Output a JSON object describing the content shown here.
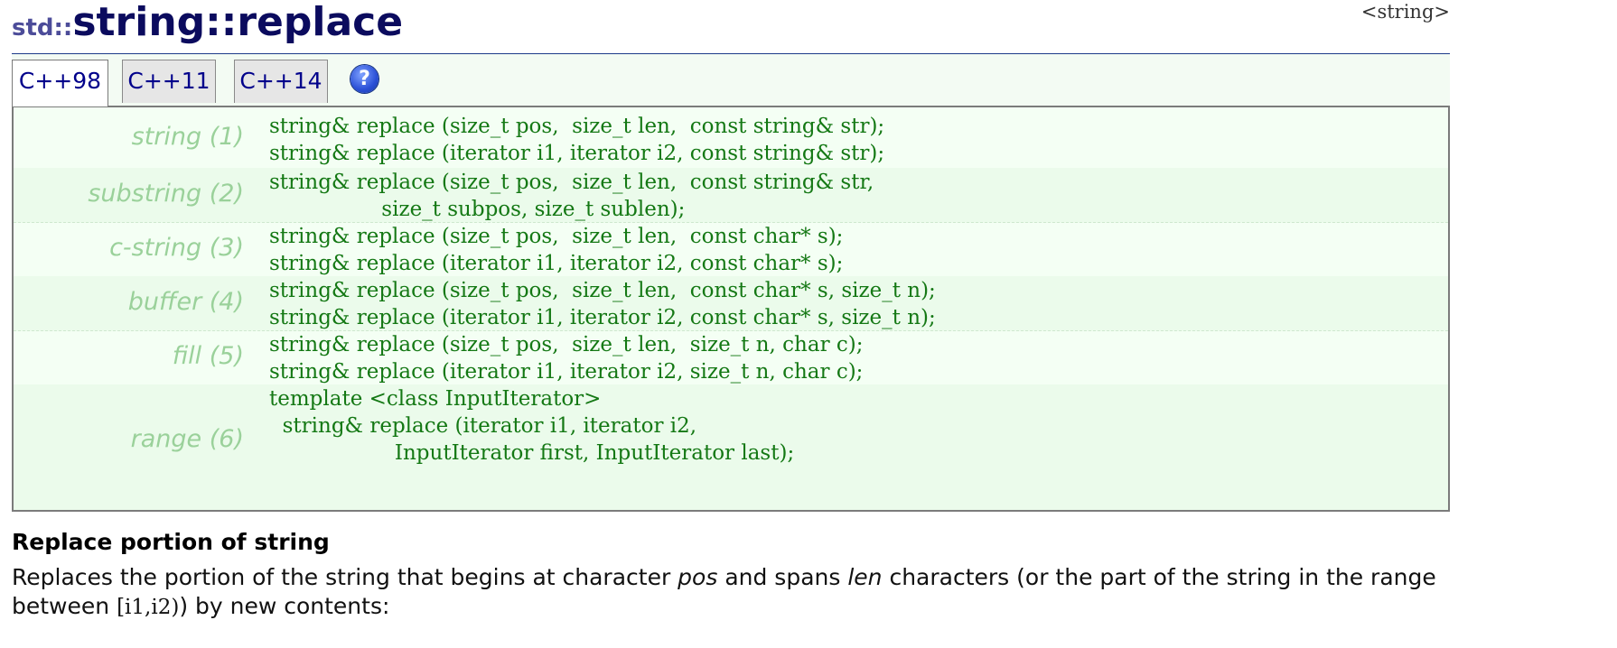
{
  "header": {
    "namespace": "std::",
    "class_name": "string",
    "separator": "::",
    "function_name": "replace",
    "header_file": "<string>"
  },
  "tabs": [
    {
      "label": "C++98",
      "active": true
    },
    {
      "label": "C++11",
      "active": false
    },
    {
      "label": "C++14",
      "active": false
    }
  ],
  "help_icon": {
    "glyph": "?",
    "icon": "help-icon"
  },
  "prototypes": [
    {
      "label": "string (1)",
      "code": "string& replace (size_t pos,  size_t len,  const string& str);\nstring& replace (iterator i1, iterator i2, const string& str);"
    },
    {
      "label": "substring (2)",
      "code": "string& replace (size_t pos,  size_t len,  const string& str,\n                 size_t subpos, size_t sublen);"
    },
    {
      "label": "c-string (3)",
      "code": "string& replace (size_t pos,  size_t len,  const char* s);\nstring& replace (iterator i1, iterator i2, const char* s);"
    },
    {
      "label": "buffer (4)",
      "code": "string& replace (size_t pos,  size_t len,  const char* s, size_t n);\nstring& replace (iterator i1, iterator i2, const char* s, size_t n);"
    },
    {
      "label": "fill (5)",
      "code": "string& replace (size_t pos,  size_t len,  size_t n, char c);\nstring& replace (iterator i1, iterator i2, size_t n, char c);"
    },
    {
      "label": "range (6)",
      "code": "template <class InputIterator>\n  string& replace (iterator i1, iterator i2,\n                   InputIterator first, InputIterator last);"
    }
  ],
  "summary": {
    "title": "Replace portion of string",
    "text1": "Replaces the portion of the string that begins at character ",
    "em1": "pos",
    "text2": " and spans ",
    "em2": "len",
    "text3": " characters (or the part of the string in the range between ",
    "code1": "[i1,i2)",
    "text4": ") by new contents:"
  },
  "colors": {
    "title": "#0b0b5e",
    "code": "#147814",
    "label": "#9ad19a",
    "rule": "#1d3b8a",
    "panel_bg": "#f4fff4"
  }
}
